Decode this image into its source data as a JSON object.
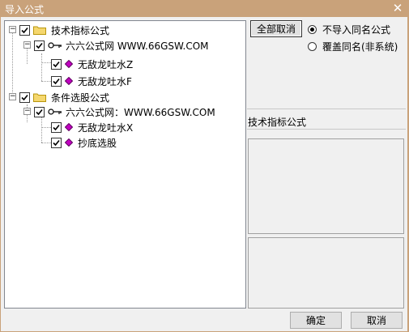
{
  "window": {
    "title": "导入公式"
  },
  "tree": {
    "groups": [
      {
        "label": "技术指标公式",
        "source": {
          "label": "六六公式网 WWW.66GSW.COM"
        },
        "items": [
          {
            "label": "无敌龙吐水Z"
          },
          {
            "label": "无敌龙吐水F"
          }
        ]
      },
      {
        "label": "条件选股公式",
        "source": {
          "label": "六六公式网：WWW.66GSW.COM"
        },
        "items": [
          {
            "label": "无敌龙吐水X"
          },
          {
            "label": "抄底选股"
          }
        ]
      }
    ]
  },
  "options": {
    "deselect_all_label": "全部取消",
    "radio_options": [
      {
        "label": "不导入同名公式",
        "selected": true
      },
      {
        "label": "覆盖同名(非系统)",
        "selected": false
      }
    ]
  },
  "info": {
    "section_title": "技术指标公式"
  },
  "footer": {
    "ok_label": "确定",
    "cancel_label": "取消"
  },
  "colors": {
    "titlebar": "#c9a27a",
    "folder": "#f5d76e",
    "gem": "#c000c0",
    "dialog_bg": "#f0f0f0"
  }
}
